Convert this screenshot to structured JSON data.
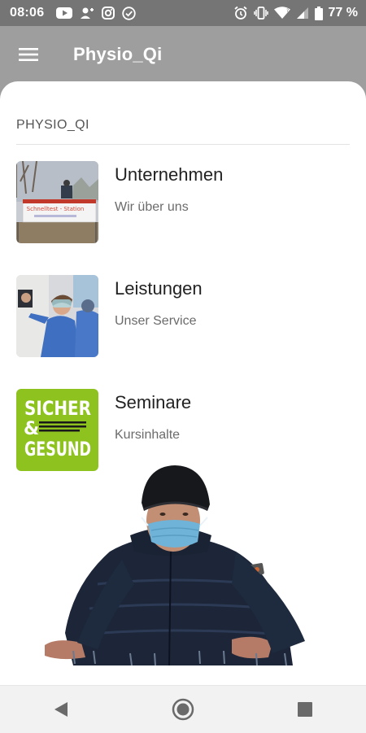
{
  "status_bar": {
    "time": "08:06",
    "battery": "77 %",
    "left_icons": [
      "youtube-icon",
      "account-icon",
      "instagram-icon",
      "check-circle-icon"
    ],
    "right_icons": [
      "alarm-icon",
      "vibrate-icon",
      "wifi-icon",
      "signal-icon",
      "battery-icon"
    ]
  },
  "app_bar": {
    "title": "Physio_Qi",
    "menu_icon": "menu-icon"
  },
  "drawer": {
    "section_header": "PHYSIO_QI",
    "items": [
      {
        "title": "Unternehmen",
        "subtitle": "Wir über uns",
        "thumbnail_text": [
          "Schnelltest - Station"
        ]
      },
      {
        "title": "Leistungen",
        "subtitle": "Unser Service"
      },
      {
        "title": "Seminare",
        "subtitle": "Kursinhalte",
        "thumbnail_text": [
          "SICHER",
          "&",
          "GESUND"
        ]
      }
    ]
  },
  "nav_bar": {
    "icons": [
      "back-icon",
      "home-icon",
      "recents-icon"
    ]
  },
  "colors": {
    "app_bar": "#9e9e9e",
    "status_bar": "#757575",
    "seminar_green": "#8dc21f"
  }
}
